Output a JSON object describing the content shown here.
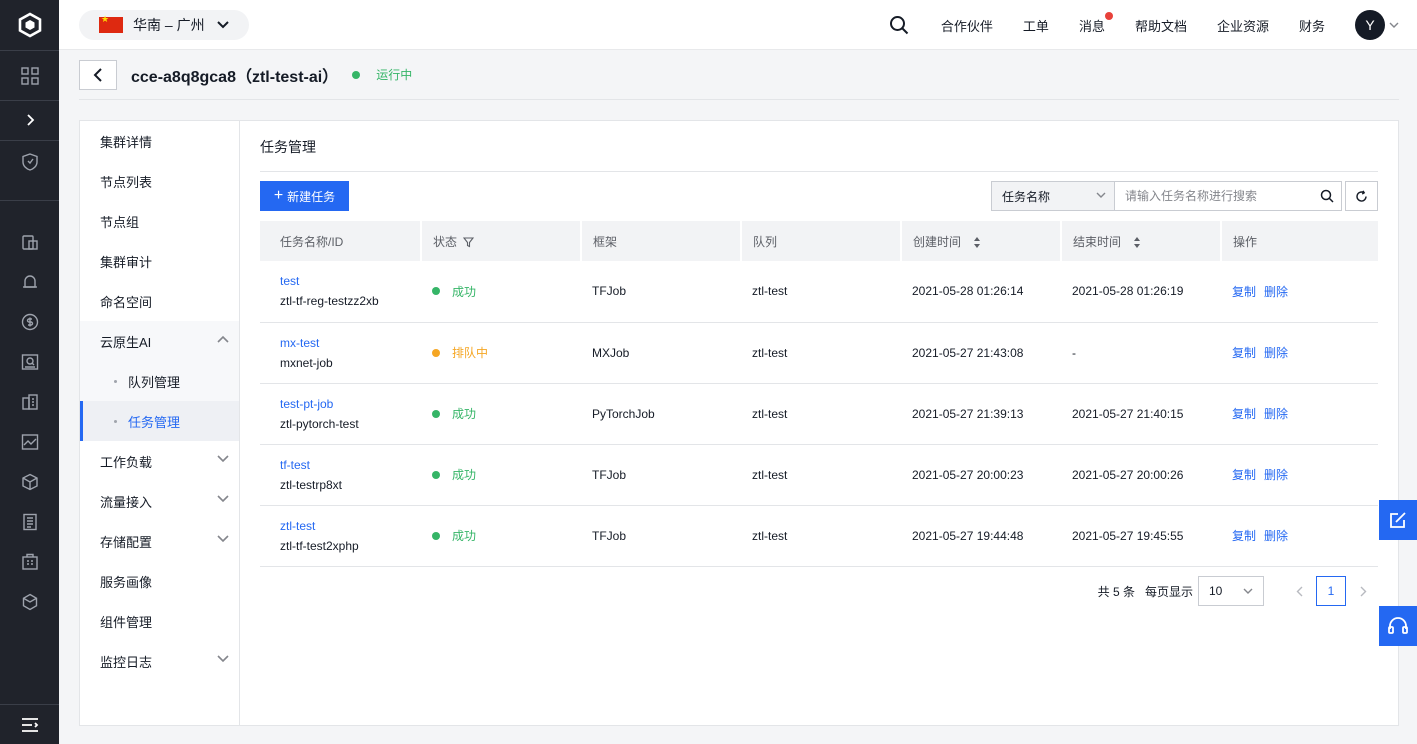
{
  "region": {
    "label": "华南 – 广州"
  },
  "topnav": {
    "items": [
      "合作伙伴",
      "工单",
      "消息",
      "帮助文档",
      "企业资源",
      "财务"
    ],
    "avatar": "Y"
  },
  "cluster": {
    "title": "cce-a8q8gca8（ztl-test-ai）",
    "status": "运行中"
  },
  "sidebar": {
    "items": [
      "集群详情",
      "节点列表",
      "节点组",
      "集群审计",
      "命名空间",
      "云原生AI"
    ],
    "sub_items": [
      "队列管理",
      "任务管理"
    ],
    "after_items": [
      "工作负载",
      "流量接入",
      "存储配置",
      "服务画像",
      "组件管理",
      "监控日志"
    ]
  },
  "content": {
    "title": "任务管理",
    "new_button": "新建任务",
    "search_select": "任务名称",
    "search_placeholder": "请输入任务名称进行搜索"
  },
  "table": {
    "headers": [
      "任务名称/ID",
      "状态",
      "框架",
      "队列",
      "创建时间",
      "结束时间",
      "操作"
    ],
    "actions": {
      "copy": "复制",
      "delete": "删除"
    },
    "rows": [
      {
        "name": "test",
        "id": "ztl-tf-reg-testzz2xb",
        "status": "成功",
        "status_color": "#35b567",
        "framework": "TFJob",
        "queue": "ztl-test",
        "created": "2021-05-28 01:26:14",
        "ended": "2021-05-28 01:26:19"
      },
      {
        "name": "mx-test",
        "id": "mxnet-job",
        "status": "排队中",
        "status_color": "#f5a623",
        "framework": "MXJob",
        "queue": "ztl-test",
        "created": "2021-05-27 21:43:08",
        "ended": "-"
      },
      {
        "name": "test-pt-job",
        "id": "ztl-pytorch-test",
        "status": "成功",
        "status_color": "#35b567",
        "framework": "PyTorchJob",
        "queue": "ztl-test",
        "created": "2021-05-27 21:39:13",
        "ended": "2021-05-27 21:40:15"
      },
      {
        "name": "tf-test",
        "id": "ztl-testrp8xt",
        "status": "成功",
        "status_color": "#35b567",
        "framework": "TFJob",
        "queue": "ztl-test",
        "created": "2021-05-27 20:00:23",
        "ended": "2021-05-27 20:00:26"
      },
      {
        "name": "ztl-test",
        "id": "ztl-tf-test2xphp",
        "status": "成功",
        "status_color": "#35b567",
        "framework": "TFJob",
        "queue": "ztl-test",
        "created": "2021-05-27 19:44:48",
        "ended": "2021-05-27 19:45:55"
      }
    ]
  },
  "pager": {
    "total": "共 5 条",
    "per_page_label": "每页显示",
    "per_page": "10",
    "current": "1"
  },
  "colors": {
    "accent": "#2468f2",
    "success": "#35b567",
    "pending": "#f5a623",
    "rail": "#20232b"
  }
}
